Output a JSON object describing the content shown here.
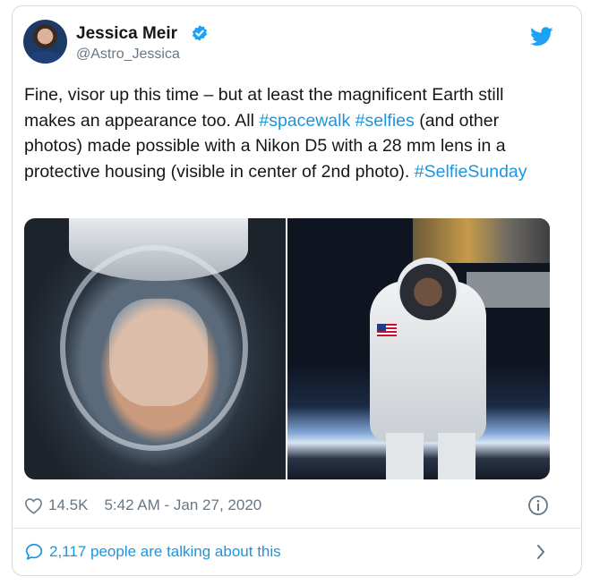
{
  "author": {
    "name": "Jessica Meir",
    "handle": "@Astro_Jessica",
    "verified_icon": "verified-badge-icon"
  },
  "tweet": {
    "segments": [
      {
        "text": "Fine, visor up this time – but at least the magnificent Earth still makes an appearance too. All ",
        "hashtag": false
      },
      {
        "text": "#spacewalk",
        "hashtag": true
      },
      {
        "text": " ",
        "hashtag": false
      },
      {
        "text": "#selfies",
        "hashtag": true
      },
      {
        "text": " (and other photos) made possible with a Nikon D5 with a 28 mm lens in a protective housing (visible in center of 2nd photo). ",
        "hashtag": false
      },
      {
        "text": "#SelfieSunday",
        "hashtag": true
      }
    ]
  },
  "media": {
    "photos": [
      "astronaut-helmet-selfie",
      "astronaut-spacewalk-earth"
    ]
  },
  "meta": {
    "likes": "14.5K",
    "timestamp": "5:42 AM - Jan 27, 2020"
  },
  "footer": {
    "talking": "2,117 people are talking about this"
  },
  "colors": {
    "link": "#1b95e0",
    "text": "#14171a",
    "muted": "#657786",
    "border": "#d6dbdf"
  }
}
